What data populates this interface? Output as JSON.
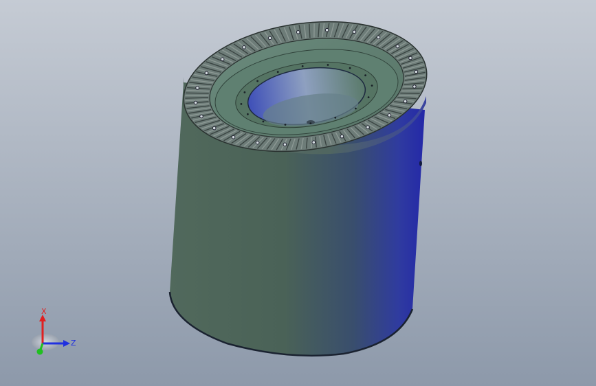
{
  "viewport": {
    "background_top": "#c4cad3",
    "background_bottom": "#8e9aab"
  },
  "model": {
    "body_color_light": "#4a6356",
    "body_color_dark": "#2b34a8",
    "gear_color": "#6f7a78",
    "bore_color": "#9aa6c8"
  },
  "triad": {
    "x_label": "X",
    "z_label": "Z",
    "x_color": "#e02020",
    "y_color": "#20c020",
    "z_color": "#2030e0"
  }
}
